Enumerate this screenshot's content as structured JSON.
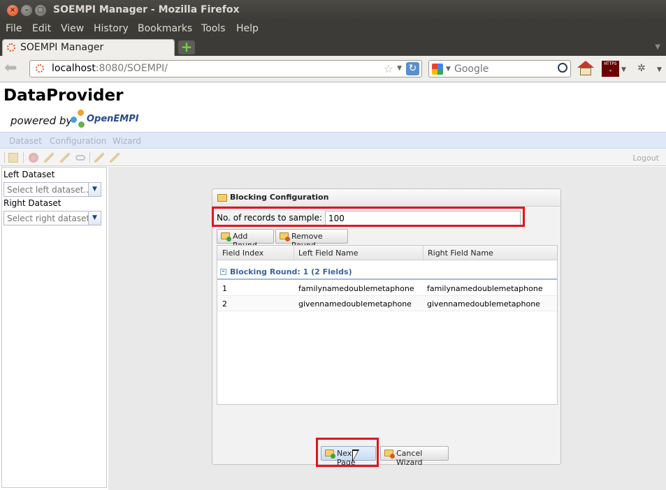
{
  "window": {
    "title": "SOEMPI Manager - Mozilla Firefox"
  },
  "menubar": {
    "items": [
      "File",
      "Edit",
      "View",
      "History",
      "Bookmarks",
      "Tools",
      "Help"
    ]
  },
  "tabs": [
    {
      "label": "SOEMPI Manager"
    }
  ],
  "navbar": {
    "url_host": "localhost",
    "url_rest": ":8080/SOEMPI/",
    "search_placeholder": "Google"
  },
  "toolbar_icons": {
    "https": "HTTPS"
  },
  "app": {
    "title": "DataProvider",
    "powered_by": "powered by",
    "logo_text": "OpenEMPI",
    "menu": [
      "Dataset",
      "Configuration",
      "Wizard"
    ],
    "logout_label": "Logout"
  },
  "left_panel": {
    "left_dataset_label": "Left Dataset",
    "left_dataset_placeholder": "Select left dataset...",
    "right_dataset_label": "Right Dataset",
    "right_dataset_placeholder": "Select right dataset..."
  },
  "dialog": {
    "title": "Blocking Configuration",
    "sample_label": "No. of records to sample:",
    "sample_value": "100",
    "add_round_label": "Add Round",
    "remove_round_label": "Remove Round",
    "columns": [
      "Field Index",
      "Left Field Name",
      "Right Field Name"
    ],
    "group_label": "Blocking Round: 1 (2 Fields)",
    "rows": [
      {
        "index": "1",
        "left": "familynamedoublemetaphone",
        "right": "familynamedoublemetaphone"
      },
      {
        "index": "2",
        "left": "givennamedoublemetaphone",
        "right": "givennamedoublemetaphone"
      }
    ],
    "next_label": "Next Page",
    "cancel_label": "Cancel Wizard"
  },
  "colors": {
    "highlight_red": "#e2151c",
    "group_blue": "#3764a0",
    "title_bar": "#3c3b37"
  }
}
